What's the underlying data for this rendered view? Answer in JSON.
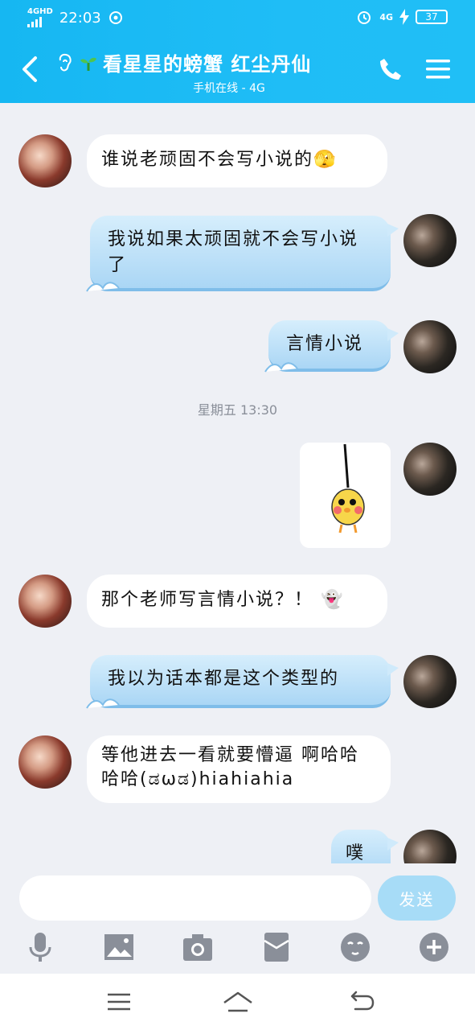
{
  "status": {
    "network": "4GHD",
    "time": "22:03",
    "net2": "4G",
    "battery": "37"
  },
  "header": {
    "contact_name": "看星星的螃蟹  红尘丹仙",
    "status_line": "手机在线 - 4G",
    "icons": {
      "back": "chevron-left-icon",
      "ear": "ear-icon",
      "sprout": "sprout-icon",
      "phone": "phone-icon",
      "menu": "menu-icon"
    }
  },
  "chat": {
    "timestamp": "星期五 13:30",
    "messages": [
      {
        "side": "left",
        "text": "谁说老顽固不会写小说的",
        "emoji": "🫣"
      },
      {
        "side": "right",
        "text": "我说如果太顽固就不会写小说了"
      },
      {
        "side": "right",
        "text": "言情小说"
      },
      {
        "side": "right",
        "type": "sticker"
      },
      {
        "side": "left",
        "text": "那个老师写言情小说？！",
        "emoji": "👻"
      },
      {
        "side": "right",
        "text": "我以为话本都是这个类型的"
      },
      {
        "side": "left",
        "text": "等他进去一看就要懵逼 啊哈哈哈哈(ಡωಡ)hiahiahia"
      },
      {
        "side": "right",
        "text": "噗"
      }
    ]
  },
  "input": {
    "placeholder": "",
    "send_label": "发送"
  },
  "toolbar": [
    "mic-icon",
    "image-icon",
    "camera-icon",
    "red-packet-icon",
    "emoji-icon",
    "plus-icon"
  ],
  "sysnav": [
    "menu-icon",
    "home-icon",
    "back-icon"
  ],
  "colors": {
    "header": "#1fbdf6",
    "send": "#a7dcf7",
    "bubble_right": "#bfe2f8"
  }
}
